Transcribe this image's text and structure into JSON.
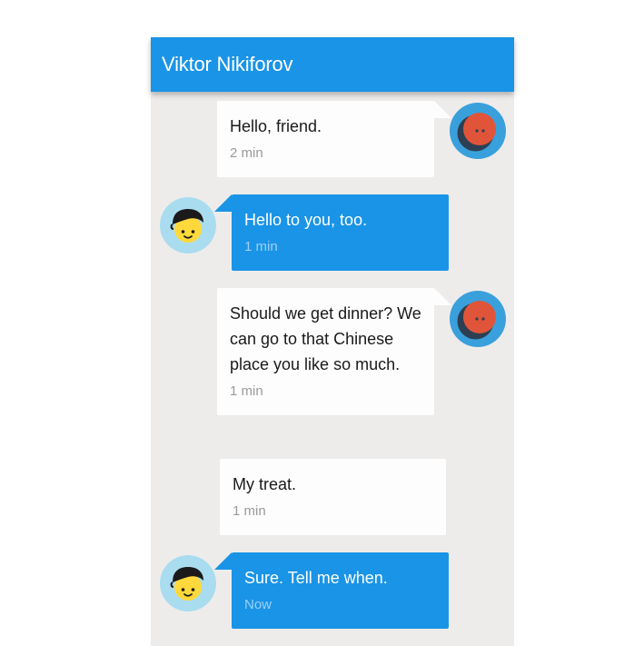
{
  "header": {
    "title": "Viktor Nikiforov",
    "color": "#1a94e6"
  },
  "messages": [
    {
      "side": "incoming",
      "text": "Hello, friend.",
      "time": "2 min",
      "avatar": "red-button-avatar-icon"
    },
    {
      "side": "outgoing",
      "text": "Hello to you, too.",
      "time": "1 min",
      "avatar": "boy-avatar-icon"
    },
    {
      "side": "incoming",
      "text": "Should we get dinner? We can go to that Chinese place you like so much.",
      "time": "1 min",
      "avatar": "red-button-avatar-icon"
    },
    {
      "side": "incoming",
      "text": "My treat.",
      "time": "1 min",
      "avatar": ""
    },
    {
      "side": "outgoing",
      "text": "Sure. Tell me when.",
      "time": "Now",
      "avatar": "boy-avatar-icon"
    }
  ],
  "colors": {
    "chat_background": "#eeeceb",
    "incoming_bubble": "#fdfdfd",
    "outgoing_bubble": "#1a94e6"
  }
}
